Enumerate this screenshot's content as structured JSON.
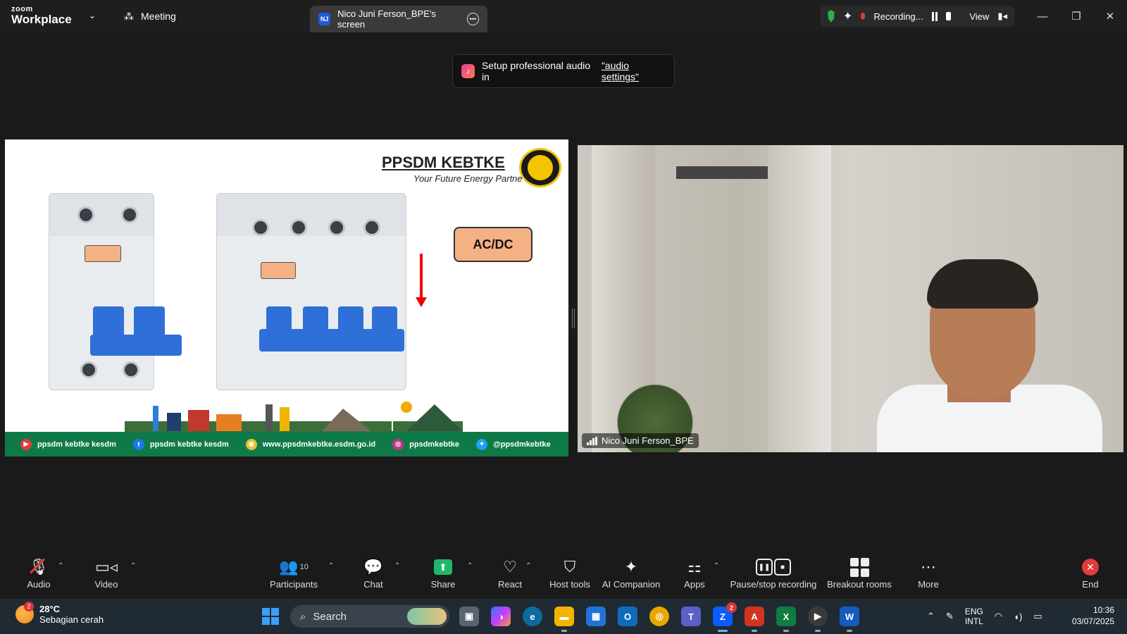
{
  "titlebar": {
    "brand_small": "zoom",
    "brand_big": "Workplace",
    "meeting_tab": "Meeting",
    "share_tab_initials": "NJ",
    "share_tab_title": "Nico Juni Ferson_BPE's screen",
    "recording_label": "Recording...",
    "view_label": "View"
  },
  "toast": {
    "text": "Setup professional audio in",
    "link": "\"audio settings\""
  },
  "slide": {
    "org": "PPSDM KEBTKE",
    "tagline": "Your Future Energy Partne",
    "acdc": "AC/DC",
    "footer": [
      {
        "icon": "youtube-icon",
        "color": "#e23b3b",
        "glyph": "▶",
        "text": "ppsdm kebtke kesdm"
      },
      {
        "icon": "facebook-icon",
        "color": "#1877f2",
        "glyph": "f",
        "text": "ppsdm kebtke kesdm"
      },
      {
        "icon": "web-icon",
        "color": "#e8c12e",
        "glyph": "◉",
        "text": "www.ppsdmkebtke.esdm.go.id"
      },
      {
        "icon": "instagram-icon",
        "color": "#c13584",
        "glyph": "◎",
        "text": "ppsdmkebtke"
      },
      {
        "icon": "twitter-icon",
        "color": "#1da1f2",
        "glyph": "✦",
        "text": "@ppsdmkebtke"
      }
    ]
  },
  "video": {
    "participant_name": "Nico Juni Ferson_BPE"
  },
  "toolbar": {
    "audio": "Audio",
    "video": "Video",
    "participants": "Participants",
    "participants_count": "10",
    "chat": "Chat",
    "share": "Share",
    "react": "React",
    "host_tools": "Host tools",
    "ai_companion": "AI Companion",
    "apps": "Apps",
    "pause_stop": "Pause/stop recording",
    "breakout": "Breakout rooms",
    "more": "More",
    "end": "End"
  },
  "taskbar": {
    "weather_badge": "2",
    "temperature": "28°C",
    "weather_desc": "Sebagian cerah",
    "search_label": "Search",
    "zoom_badge": "2",
    "lang_top": "ENG",
    "lang_bottom": "INTL",
    "time": "10:36",
    "date": "03/07/2025"
  },
  "colors": {
    "share_green": "#1fb86a",
    "record_red": "#e23b3b",
    "acdc_fill": "#f4b183",
    "slide_footer_green": "#0f7a48"
  }
}
